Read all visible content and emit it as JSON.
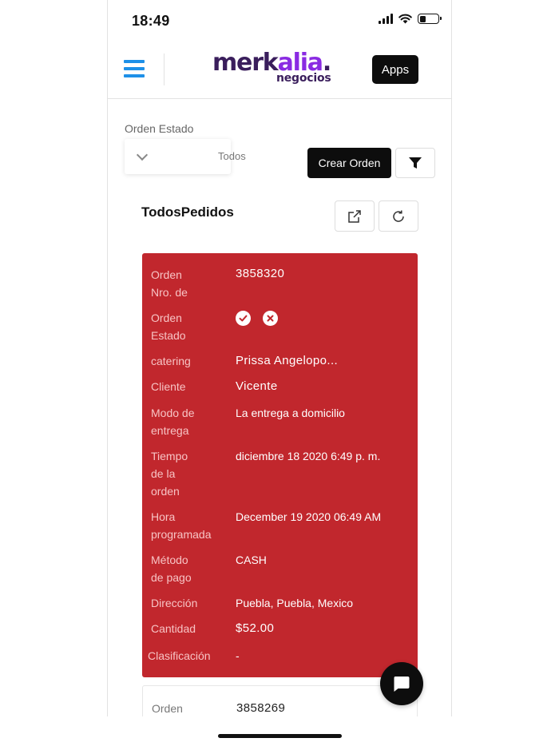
{
  "status_bar": {
    "time": "18:49"
  },
  "header": {
    "logo_part1": "merk",
    "logo_part2": "alia",
    "logo_part3": ".",
    "logo_sub": "negocios",
    "apps_label": "Apps"
  },
  "filters": {
    "estado_label": "Orden Estado",
    "estado_value": "Todos",
    "crear_label": "Crear Orden"
  },
  "section": {
    "title": "TodosPedidos"
  },
  "order1": {
    "nro_label": "Orden\nNro. de",
    "nro_value": "3858320",
    "estado_label": "Orden\nEstado",
    "catering_label": "catering",
    "catering_value": "Prissa Angelopo...",
    "cliente_label": "Cliente",
    "cliente_value": "Vicente",
    "modo_label": "Modo de\nentrega",
    "modo_value": "La entrega a domicilio",
    "tiempo_label": "Tiempo\nde la\norden",
    "tiempo_value": "diciembre 18 2020 6:49 p. m.",
    "hora_label": "Hora\nprogramada",
    "hora_value": "December 19 2020 06:49 AM",
    "metodo_label": "Método\nde pago",
    "metodo_value": "CASH",
    "direccion_label": "Dirección",
    "direccion_value": "Puebla, Puebla, Mexico",
    "cantidad_label": "Cantidad",
    "cantidad_value": "$52.00",
    "clasificacion_label": "Clasificación",
    "clasificacion_value": "-"
  },
  "order2": {
    "nro_label": "Orden",
    "nro_value": "3858269"
  },
  "colors": {
    "accent_blue": "#1e90e8",
    "card_red": "#c1272d",
    "brand_dark": "#3a1e5c",
    "brand_purple": "#8a2be2"
  }
}
